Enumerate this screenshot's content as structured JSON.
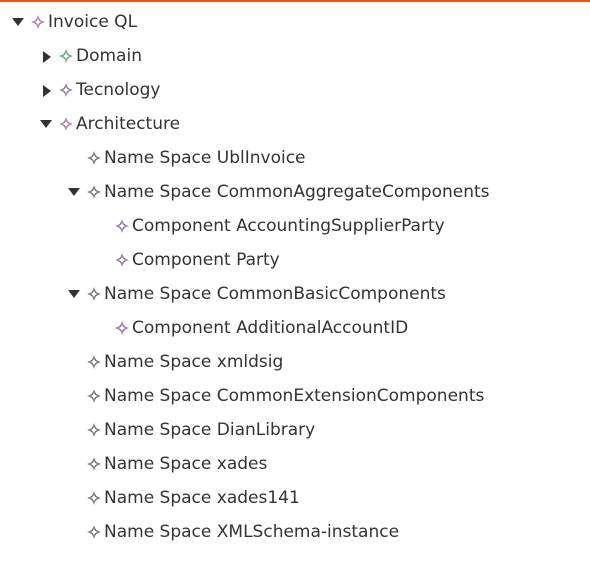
{
  "colors": {
    "accent_top_border": "#e95420",
    "text": "#333333",
    "twisty": "#333333",
    "icon_gray": "#6b6b6b",
    "icon_green": "#5e9a78",
    "icon_purple": "#a070b8"
  },
  "tree": {
    "root": {
      "label": "Invoice QL",
      "icon": "node-diamond-icon",
      "expanded": true,
      "children": {
        "domain": {
          "label": "Domain",
          "icon": "node-diamond-icon",
          "expanded": false
        },
        "tecnology": {
          "label": "Tecnology",
          "icon": "node-diamond-icon",
          "expanded": false
        },
        "architecture": {
          "label": "Architecture",
          "icon": "node-diamond-icon",
          "expanded": true,
          "children": {
            "ns_ublinvoice": {
              "label": "Name Space UblInvoice"
            },
            "ns_common_aggregate": {
              "label": "Name Space CommonAggregateComponents",
              "expanded": true,
              "children": {
                "c_accounting_supplier": {
                  "label": "Component AccountingSupplierParty"
                },
                "c_party": {
                  "label": "Component Party"
                }
              }
            },
            "ns_common_basic": {
              "label": "Name Space CommonBasicComponents",
              "expanded": true,
              "children": {
                "c_additional_account": {
                  "label": "Component AdditionalAccountID"
                }
              }
            },
            "ns_xmldsig": {
              "label": "Name Space xmldsig"
            },
            "ns_common_extension": {
              "label": "Name Space CommonExtensionComponents"
            },
            "ns_dianlibrary": {
              "label": "Name Space DianLibrary"
            },
            "ns_xades": {
              "label": "Name Space xades"
            },
            "ns_xades141": {
              "label": "Name Space xades141"
            },
            "ns_xmlschema_instance": {
              "label": "Name Space XMLSchema-instance"
            }
          }
        }
      }
    }
  }
}
